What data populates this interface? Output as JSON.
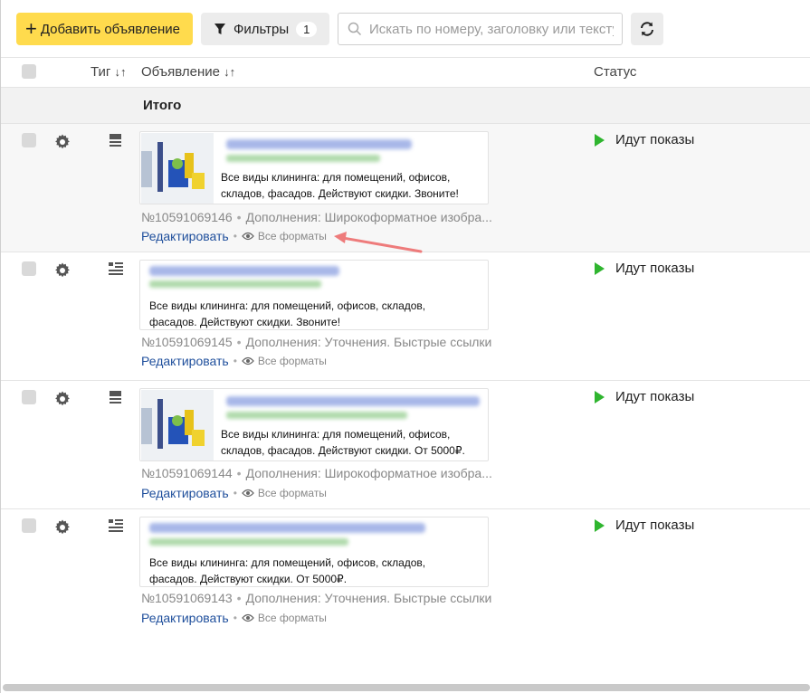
{
  "toolbar": {
    "add_label": "Добавить объявление",
    "filters_label": "Фильтры",
    "filters_count": "1",
    "search_placeholder": "Искать по номеру, заголовку или тексту",
    "search_value": ""
  },
  "table": {
    "columns": {
      "type": "Тиг",
      "ad": "Объявление",
      "status": "Статус",
      "sort_icon": "sort-arrows-icon"
    },
    "total_label": "Итого",
    "rows": [
      {
        "type_icon": "image-ad-icon",
        "has_image": true,
        "description": "Все виды клининга: для помещений, офисов, складов, фасадов. Действуют скидки. Звоните!",
        "number": "№10591069146",
        "extras": "Дополнения: Широкоформатное изобра...",
        "edit_label": "Редактировать",
        "formats_label": "Все форматы",
        "status": "Идут показы"
      },
      {
        "type_icon": "text-ad-icon",
        "has_image": false,
        "description": "Все виды клининга: для помещений, офисов, складов, фасадов. Действуют скидки. Звоните!",
        "number": "№10591069145",
        "extras": "Дополнения: Уточнения. Быстрые ссылки",
        "edit_label": "Редактировать",
        "formats_label": "Все форматы",
        "status": "Идут показы"
      },
      {
        "type_icon": "image-ad-icon",
        "has_image": true,
        "description": "Все виды клининга: для помещений, офисов, складов, фасадов. Действуют скидки. От 5000₽.",
        "number": "№10591069144",
        "extras": "Дополнения: Широкоформатное изобра...",
        "edit_label": "Редактировать",
        "formats_label": "Все форматы",
        "status": "Идут показы"
      },
      {
        "type_icon": "text-ad-icon",
        "has_image": false,
        "description": "Все виды клининга: для помещений, офисов, складов, фасадов. Действуют скидки. От 5000₽.",
        "number": "№10591069143",
        "extras": "Дополнения: Уточнения. Быстрые ссылки",
        "edit_label": "Редактировать",
        "formats_label": "Все форматы",
        "status": "Идут показы"
      }
    ]
  },
  "colors": {
    "accent_yellow": "#ffdb4d",
    "status_green": "#2fb52f",
    "link_blue": "#1f4f9c",
    "annotation_arrow": "#ee7b7b"
  }
}
